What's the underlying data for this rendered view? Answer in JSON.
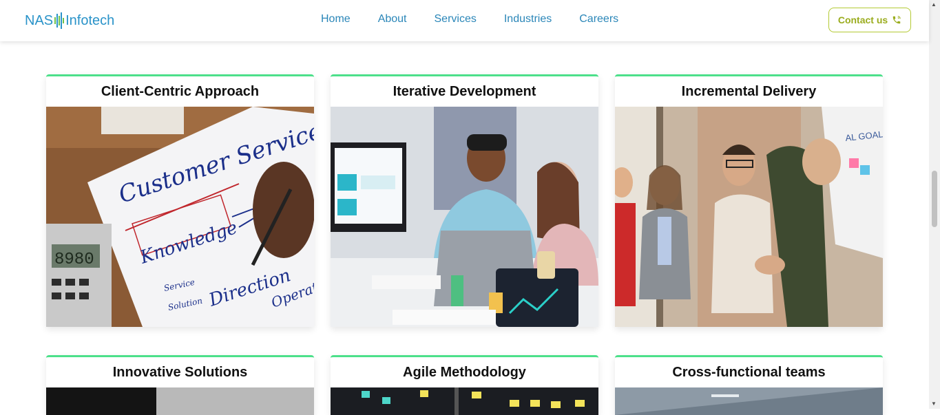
{
  "brand": {
    "part1": "NAS",
    "part2": "Infotech"
  },
  "nav": {
    "links": [
      "Home",
      "About",
      "Services",
      "Industries",
      "Careers"
    ],
    "contact_label": "Contact us"
  },
  "cards": [
    {
      "title": "Client-Centric Approach",
      "image": "customer-service-note-photo",
      "img_text": [
        "Customer Service",
        "Knowledge",
        "Direction",
        "Service",
        "Solution",
        "Operation"
      ]
    },
    {
      "title": "Iterative Development",
      "image": "team-at-computer-photo"
    },
    {
      "title": "Incremental Delivery",
      "image": "business-handshake-photo",
      "img_text": [
        "AL GOALS"
      ]
    },
    {
      "title": "Innovative Solutions",
      "image": "dark-office-photo"
    },
    {
      "title": "Agile Methodology",
      "image": "sticky-notes-board-photo"
    },
    {
      "title": "Cross-functional teams",
      "image": "office-ceiling-photo"
    }
  ],
  "colors": {
    "accent_green": "#4ce08a",
    "nav_blue": "#2a86b8",
    "contact_olive": "#9aac1d"
  }
}
